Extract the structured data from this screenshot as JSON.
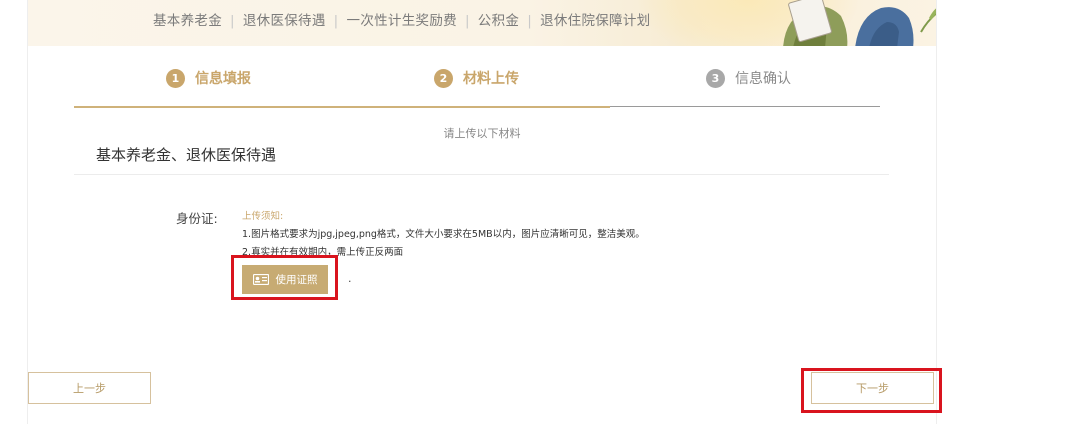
{
  "nav": {
    "links": [
      "基本养老金",
      "退休医保待遇",
      "一次性计生奖励费",
      "公积金",
      "退休住院保障计划"
    ]
  },
  "steps": [
    {
      "number": "1",
      "label": "信息填报",
      "state": "active"
    },
    {
      "number": "2",
      "label": "材料上传",
      "state": "active"
    },
    {
      "number": "3",
      "label": "信息确认",
      "state": "inactive"
    }
  ],
  "main": {
    "upload_prompt": "请上传以下材料",
    "category_title": "基本养老金、退休医保待遇",
    "id_card": {
      "label": "身份证:",
      "notice_title": "上传须知:",
      "notice_lines": [
        "1.图片格式要求为jpg,jpeg,png格式，文件大小要求在5MB以内，图片应清晰可见，整洁美观。",
        "2.真实并在有效期内，需上传正反两面"
      ],
      "upload_button": "使用证照",
      "upload_icon": "id-card-icon",
      "status_mark": "."
    }
  },
  "footer": {
    "prev_button": "上一步",
    "next_button": "下一步"
  },
  "colors": {
    "accent": "#c9a66b",
    "button_fill": "#c7ab73",
    "highlight": "#d9141e",
    "inactive": "#a8a8a8"
  }
}
